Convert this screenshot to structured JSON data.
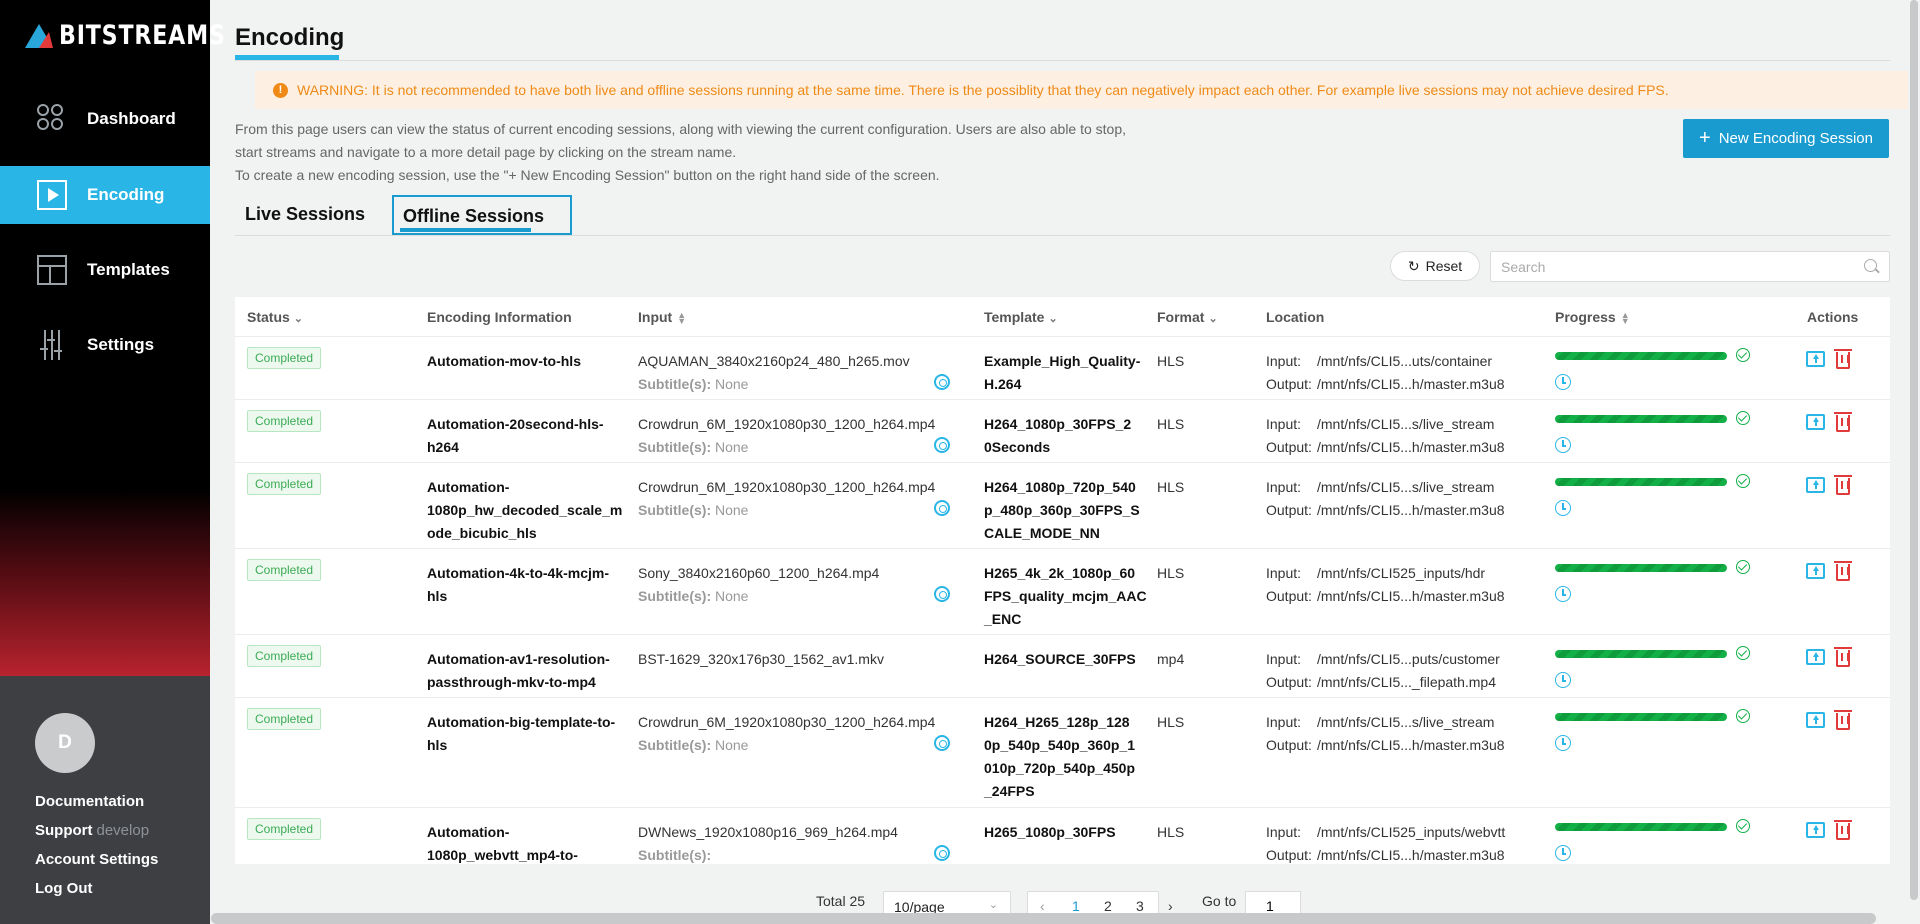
{
  "brand": {
    "name": "BITSTREAMS"
  },
  "nav": [
    {
      "label": "Dashboard",
      "active": false,
      "icon": "dashboard-icon"
    },
    {
      "label": "Encoding",
      "active": true,
      "icon": "play-square-icon"
    },
    {
      "label": "Templates",
      "active": false,
      "icon": "layout-icon"
    },
    {
      "label": "Settings",
      "active": false,
      "icon": "sliders-icon"
    }
  ],
  "user": {
    "initial": "D"
  },
  "bottom_links": {
    "documentation": "Documentation",
    "support": "Support",
    "support_version": "develop",
    "account": "Account Settings",
    "logout": "Log Out"
  },
  "page": {
    "title": "Encoding",
    "warning": "WARNING: It is not recommended to have both live and offline sessions running at the same time. There is the possiblity that they can negatively impact each other. For example live sessions may not achieve desired FPS.",
    "desc_line1": "From this page users can view the status of current encoding sessions, along with viewing the current configuration. Users are also able to stop,",
    "desc_line2": "start streams and navigate to a more detail page by clicking on the stream name.",
    "desc_line3": "To create a new encoding session, use the \"+ New Encoding Session\" button on the right hand side of the screen.",
    "new_button": "New Encoding Session"
  },
  "tabs": {
    "live": "Live Sessions",
    "offline": "Offline Sessions"
  },
  "toolbar": {
    "reset": "Reset",
    "search_placeholder": "Search"
  },
  "table": {
    "headers": {
      "status": "Status",
      "info": "Encoding Information",
      "input": "Input",
      "template": "Template",
      "format": "Format",
      "location": "Location",
      "progress": "Progress",
      "actions": "Actions"
    },
    "subtitle_label": "Subtitle(s):",
    "input_label": "Input:",
    "output_label": "Output:",
    "rows": [
      {
        "status": "Completed",
        "info": [
          "Automation-mov-to-hls"
        ],
        "input": "AQUAMAN_3840x2160p24_480_h265.mov",
        "subtitle": "None",
        "template": [
          "Example_High_Quality-",
          "H.264"
        ],
        "format": "HLS",
        "loc_in": "/mnt/nfs/CLI5...uts/container",
        "loc_out": "/mnt/nfs/CLI5...h/master.m3u8",
        "progress": 100
      },
      {
        "status": "Completed",
        "info": [
          "Automation-20second-hls-",
          "h264"
        ],
        "input": "Crowdrun_6M_1920x1080p30_1200_h264.mp4",
        "subtitle": "None",
        "template": [
          "H264_1080p_30FPS_2",
          "0Seconds"
        ],
        "format": "HLS",
        "loc_in": "/mnt/nfs/CLI5...s/live_stream",
        "loc_out": "/mnt/nfs/CLI5...h/master.m3u8",
        "progress": 100
      },
      {
        "status": "Completed",
        "info": [
          "Automation-",
          "1080p_hw_decoded_scale_m",
          "ode_bicubic_hls"
        ],
        "input": "Crowdrun_6M_1920x1080p30_1200_h264.mp4",
        "subtitle": "None",
        "template": [
          "H264_1080p_720p_540",
          "p_480p_360p_30FPS_S",
          "CALE_MODE_NN"
        ],
        "format": "HLS",
        "loc_in": "/mnt/nfs/CLI5...s/live_stream",
        "loc_out": "/mnt/nfs/CLI5...h/master.m3u8",
        "progress": 100
      },
      {
        "status": "Completed",
        "info": [
          "Automation-4k-to-4k-mcjm-",
          "hls"
        ],
        "input": "Sony_3840x2160p60_1200_h264.mp4",
        "subtitle": "None",
        "template": [
          "H265_4k_2k_1080p_60",
          "FPS_quality_mcjm_AAC",
          "_ENC"
        ],
        "format": "HLS",
        "loc_in": "/mnt/nfs/CLI525_inputs/hdr",
        "loc_out": "/mnt/nfs/CLI5...h/master.m3u8",
        "progress": 100
      },
      {
        "status": "Completed",
        "info": [
          "Automation-av1-resolution-",
          "passthrough-mkv-to-mp4"
        ],
        "input": "BST-1629_320x176p30_1562_av1.mkv",
        "subtitle": null,
        "template": [
          "H264_SOURCE_30FPS"
        ],
        "format": "mp4",
        "loc_in": "/mnt/nfs/CLI5...puts/customer",
        "loc_out": "/mnt/nfs/CLI5..._filepath.mp4",
        "progress": 100
      },
      {
        "status": "Completed",
        "info": [
          "Automation-big-template-to-",
          "hls"
        ],
        "input": "Crowdrun_6M_1920x1080p30_1200_h264.mp4",
        "subtitle": "None",
        "template": [
          "H264_H265_128p_128",
          "0p_540p_540p_360p_1",
          "010p_720p_540p_450p",
          "_24FPS"
        ],
        "format": "HLS",
        "loc_in": "/mnt/nfs/CLI5...s/live_stream",
        "loc_out": "/mnt/nfs/CLI5...h/master.m3u8",
        "progress": 100
      },
      {
        "status": "Completed",
        "info": [
          "Automation-",
          "1080p_webvtt_mp4-to-"
        ],
        "input": "DWNews_1920x1080p16_969_h264.mp4",
        "subtitle": "",
        "template": [
          "H265_1080p_30FPS"
        ],
        "format": "HLS",
        "loc_in": "/mnt/nfs/CLI525_inputs/webvtt",
        "loc_out": "/mnt/nfs/CLI5...h/master.m3u8",
        "progress": 100
      }
    ]
  },
  "pagination": {
    "total": "Total 25",
    "page_size": "10/page",
    "pages": [
      "1",
      "2",
      "3"
    ],
    "current": "1",
    "goto_label": "Go to",
    "goto_value": "1"
  }
}
